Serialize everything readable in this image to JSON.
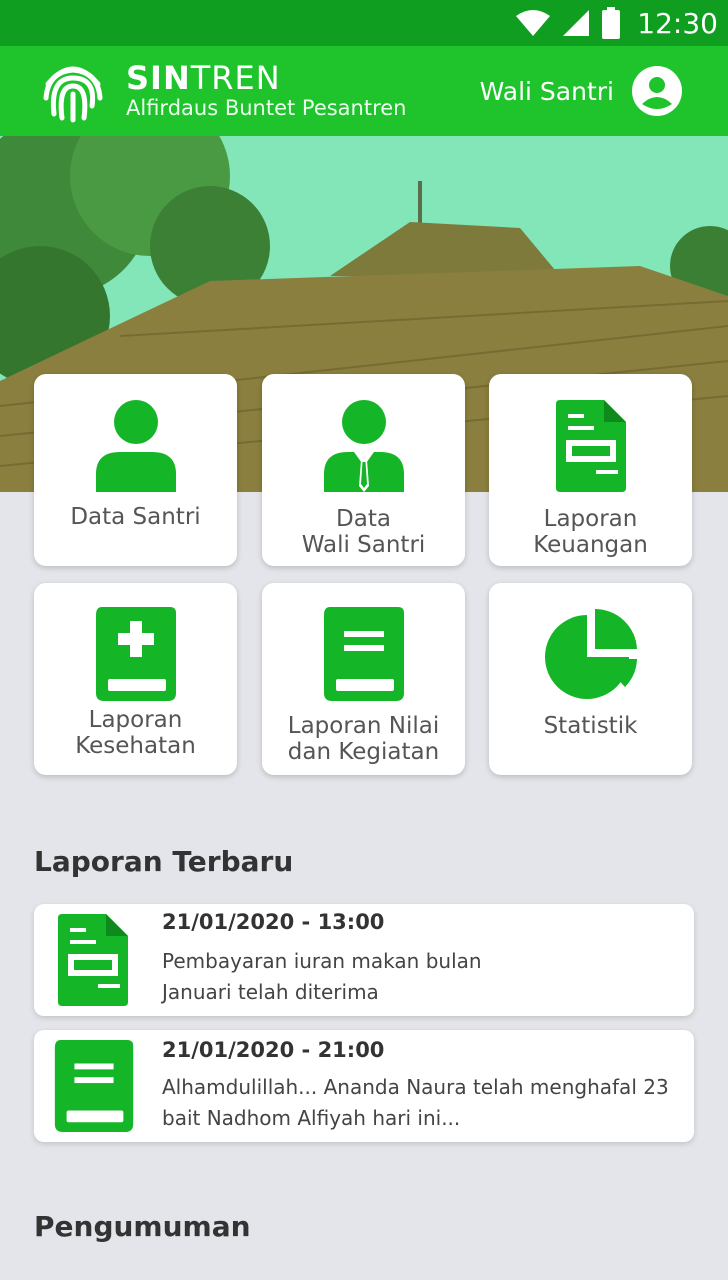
{
  "status_bar": {
    "time": "12:30",
    "icons": [
      "wifi-icon",
      "signal-icon",
      "battery-icon"
    ]
  },
  "app_bar": {
    "brand_bold": "SIN",
    "brand_light": "TREN",
    "subtitle": "Alfirdaus Buntet Pesantren",
    "user_label": "Wali Santri",
    "logo_icon": "fingerprint-icon",
    "avatar_icon": "account-circle-icon"
  },
  "menu": {
    "tiles": [
      {
        "line1": "Data Santri",
        "line2": "",
        "icon": "person-icon"
      },
      {
        "line1": "Data",
        "line2": "Wali Santri",
        "icon": "person-tie-icon"
      },
      {
        "line1": "Laporan",
        "line2": "Keuangan",
        "icon": "document-icon"
      },
      {
        "line1": "Laporan",
        "line2": "Kesehatan",
        "icon": "medical-book-icon"
      },
      {
        "line1": "Laporan Nilai",
        "line2": "dan Kegiatan",
        "icon": "book-icon"
      },
      {
        "line1": "Statistik",
        "line2": "",
        "icon": "pie-chart-icon"
      }
    ]
  },
  "latest": {
    "title": "Laporan Terbaru",
    "items": [
      {
        "date": "21/01/2020 - 13:00",
        "line1": "Pembayaran iuran makan bulan",
        "line2": "Januari telah diterima",
        "icon": "document-icon"
      },
      {
        "date": "21/01/2020 - 21:00",
        "line1": "Alhamdulillah... Ananda Naura telah menghafal 23",
        "line2": "bait Nadhom Alfiyah hari ini...",
        "icon": "book-icon"
      }
    ]
  },
  "announcements": {
    "title": "Pengumuman"
  },
  "colors": {
    "primary": "#1fc42d",
    "status": "#0f9e20",
    "icon": "#14b527",
    "background": "#e3e5ea"
  }
}
